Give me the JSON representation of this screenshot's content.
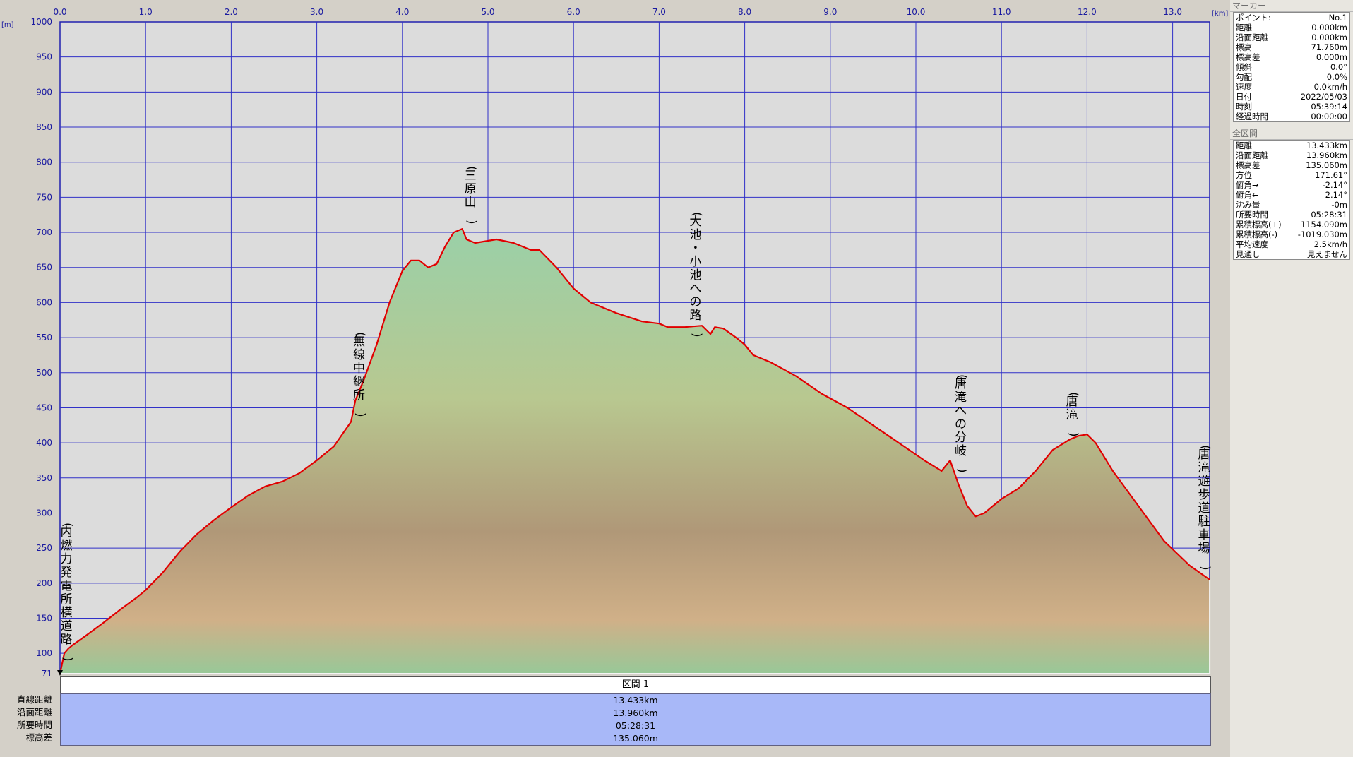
{
  "chart_data": {
    "type": "area",
    "x_unit": "[km]",
    "y_unit": "[m]",
    "xlim": [
      0,
      13.433
    ],
    "ylim": [
      71,
      1000
    ],
    "x_ticks": [
      "0.0",
      "1.0",
      "2.0",
      "3.0",
      "4.0",
      "5.0",
      "6.0",
      "7.0",
      "8.0",
      "9.0",
      "10.0",
      "11.0",
      "12.0",
      "13.0"
    ],
    "y_ticks": [
      1000,
      950,
      900,
      850,
      800,
      750,
      700,
      650,
      600,
      550,
      500,
      450,
      400,
      350,
      300,
      250,
      200,
      150,
      100,
      71
    ],
    "grid": true,
    "series": [
      {
        "color": "#e00000",
        "x": [
          0,
          0.05,
          0.1,
          0.15,
          0.3,
          0.5,
          0.7,
          0.9,
          1.0,
          1.2,
          1.4,
          1.6,
          1.8,
          2.0,
          2.2,
          2.4,
          2.6,
          2.8,
          3.0,
          3.2,
          3.4,
          3.45,
          3.55,
          3.7,
          3.85,
          4.0,
          4.1,
          4.2,
          4.3,
          4.4,
          4.5,
          4.6,
          4.7,
          4.75,
          4.85,
          5.0,
          5.1,
          5.3,
          5.5,
          5.6,
          5.8,
          6.0,
          6.2,
          6.5,
          6.8,
          7.0,
          7.1,
          7.3,
          7.5,
          7.6,
          7.65,
          7.75,
          7.9,
          8.0,
          8.1,
          8.3,
          8.6,
          8.9,
          9.2,
          9.5,
          9.8,
          10.1,
          10.3,
          10.4,
          10.5,
          10.6,
          10.7,
          10.8,
          10.9,
          11.0,
          11.2,
          11.4,
          11.6,
          11.8,
          11.9,
          12.0,
          12.1,
          12.3,
          12.6,
          12.9,
          13.2,
          13.433
        ],
        "y": [
          71,
          100,
          107,
          112,
          125,
          143,
          162,
          180,
          190,
          215,
          245,
          270,
          290,
          308,
          325,
          338,
          345,
          357,
          375,
          395,
          430,
          460,
          490,
          540,
          600,
          645,
          660,
          660,
          650,
          655,
          680,
          700,
          705,
          690,
          685,
          688,
          690,
          685,
          675,
          675,
          650,
          620,
          600,
          585,
          573,
          570,
          565,
          565,
          567,
          555,
          565,
          563,
          550,
          540,
          525,
          515,
          495,
          470,
          450,
          425,
          400,
          375,
          360,
          375,
          340,
          310,
          295,
          300,
          310,
          320,
          335,
          360,
          390,
          405,
          410,
          412,
          400,
          360,
          310,
          260,
          225,
          205
        ]
      }
    ],
    "annotations": [
      {
        "x": 0.0,
        "text": "(内燃力発電所横道路)"
      },
      {
        "x": 3.42,
        "text": "(無線中継所)"
      },
      {
        "x": 4.72,
        "text": "(三原山)"
      },
      {
        "x": 7.35,
        "text": "(大池・小池への路)"
      },
      {
        "x": 10.45,
        "text": "(唐滝への分岐)"
      },
      {
        "x": 11.75,
        "text": "(唐滝)"
      },
      {
        "x": 13.43,
        "text": "(唐滝遊歩道駐車場)"
      }
    ]
  },
  "marker_panel": {
    "header": "マーカー",
    "rows": [
      {
        "label": "ポイント:",
        "value": "No.1"
      },
      {
        "label": "距離",
        "value": "0.000km"
      },
      {
        "label": "沿面距離",
        "value": "0.000km"
      },
      {
        "label": "標高",
        "value": "71.760m"
      },
      {
        "label": "標高差",
        "value": "0.000m"
      },
      {
        "label": "傾斜",
        "value": "0.0°"
      },
      {
        "label": "勾配",
        "value": "0.0%"
      },
      {
        "label": "速度",
        "value": "0.0km/h"
      },
      {
        "label": "日付",
        "value": "2022/05/03"
      },
      {
        "label": "時刻",
        "value": "05:39:14"
      },
      {
        "label": "経過時間",
        "value": "00:00:00"
      }
    ]
  },
  "total_panel": {
    "header": "全区間",
    "rows": [
      {
        "label": "距離",
        "value": "13.433km"
      },
      {
        "label": "沿面距離",
        "value": "13.960km"
      },
      {
        "label": "標高差",
        "value": "135.060m"
      },
      {
        "label": "方位",
        "value": "171.61°"
      },
      {
        "label": "俯角→",
        "value": "-2.14°"
      },
      {
        "label": "俯角←",
        "value": "2.14°"
      },
      {
        "label": "沈み量",
        "value": "-0m"
      },
      {
        "label": "所要時間",
        "value": "05:28:31"
      },
      {
        "label": "累積標高(+)",
        "value": "1154.090m"
      },
      {
        "label": "累積標高(-)",
        "value": "-1019.030m"
      },
      {
        "label": "平均速度",
        "value": "2.5km/h"
      },
      {
        "label": "見通し",
        "value": "見えません"
      }
    ]
  },
  "section": {
    "title": "区間 1",
    "labels": [
      "直線距離",
      "沿面距離",
      "所要時間",
      "標高差"
    ],
    "values": [
      "13.433km",
      "13.960km",
      "05:28:31",
      "135.060m"
    ]
  }
}
